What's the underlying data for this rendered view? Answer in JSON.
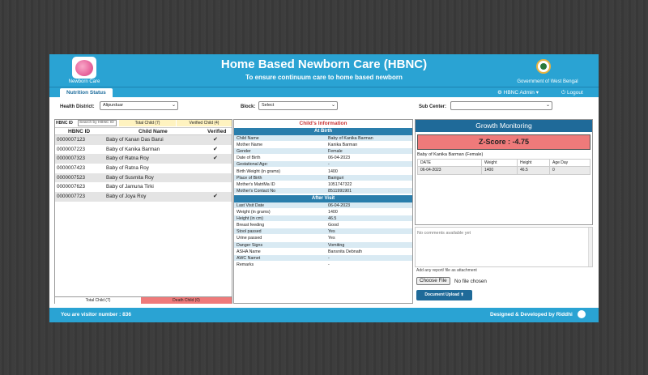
{
  "header": {
    "logo_caption": "Newborn Care",
    "title": "Home Based Newborn Care (HBNC)",
    "subtitle": "To ensure continuum care to home based newborn",
    "gov_caption": "Government of West Bengal"
  },
  "nav": {
    "tab": "Nutrition Status",
    "admin": "⚙ HBNC Admin ▾",
    "logout": "⏻ Logout"
  },
  "filters": {
    "district_label": "Health District:",
    "district_value": "Alipurduar",
    "block_label": "Block:",
    "block_value": "Select",
    "subcenter_label": "Sub Center:",
    "subcenter_value": ""
  },
  "list": {
    "search_label": "HBNC ID",
    "search_placeholder": "Search by HBNC ID",
    "total_badge": "Total Child (7)",
    "verified_badge": "Verified Child (4)",
    "col_id": "HBNC ID",
    "col_name": "Child Name",
    "col_verified": "Verified",
    "rows": [
      {
        "id": "0000007123",
        "name": "Baby of Kanan Das Barui",
        "verified": "✔"
      },
      {
        "id": "0000007223",
        "name": "Baby of Kanika Barman",
        "verified": "✔"
      },
      {
        "id": "0000007323",
        "name": "Baby of Ratna Roy",
        "verified": "✔"
      },
      {
        "id": "0000007423",
        "name": "Baby of Ratna Roy",
        "verified": ""
      },
      {
        "id": "0000007523",
        "name": "Baby of Susmita Roy",
        "verified": ""
      },
      {
        "id": "0000007623",
        "name": "Baby of Jamuna Tirki",
        "verified": ""
      },
      {
        "id": "0000007723",
        "name": "Baby of Joya Roy",
        "verified": "✔"
      }
    ],
    "footer_total": "Total Child (7)",
    "footer_death": "Death Child (0)"
  },
  "info": {
    "title": "Child's Information",
    "at_birth_label": "At Birth",
    "at_birth": [
      {
        "k": "Child Name",
        "v": "Baby of Kanika Barman"
      },
      {
        "k": "Mother Name",
        "v": "Kanika Barman"
      },
      {
        "k": "Gender",
        "v": "Female"
      },
      {
        "k": "Date of Birth",
        "v": "06-04-2023"
      },
      {
        "k": "Gestational Age:",
        "v": "-"
      },
      {
        "k": "Birth Weight (in grams)",
        "v": "1400"
      },
      {
        "k": "Place of Birth",
        "v": "Bairiguri"
      },
      {
        "k": "Mother's MatriMa ID",
        "v": "1051747322"
      },
      {
        "k": "Mother's Contact No",
        "v": "8511991901"
      }
    ],
    "after_visit_label": "After Visit",
    "after_visit": [
      {
        "k": "Last Visit Date",
        "v": "06-04-2023"
      },
      {
        "k": "Weight (in grams)",
        "v": "1400"
      },
      {
        "k": "Height (in cm)",
        "v": "46.5"
      },
      {
        "k": "Breast feeding",
        "v": "Good"
      },
      {
        "k": "Stool passed",
        "v": "Yes"
      },
      {
        "k": "Urine passed",
        "v": "Yes"
      },
      {
        "k": "Danger Signs",
        "v": "Vomiting"
      },
      {
        "k": "ASHA Name",
        "v": "Bansnita Debnath"
      },
      {
        "k": "AWC Namet",
        "v": "-"
      },
      {
        "k": "Remarks",
        "v": "-"
      }
    ]
  },
  "growth": {
    "title": "Growth Monitoring",
    "zscore": "Z-Score : -4.75",
    "baby": "Baby of Kanika Barman (Female)",
    "columns": [
      "DATE",
      "Weight",
      "Height",
      "Age Day"
    ],
    "row": [
      "06-04-2023",
      "1400",
      "46.5",
      "0"
    ],
    "comments_placeholder": "No comments available yet",
    "attach_label": "Add any report/ file as attachment",
    "file_button": "Choose File",
    "file_text": "No file chosen",
    "upload_button": "Document Upload ⬆"
  },
  "footer": {
    "visitor": "You are visitor number :   836",
    "credit": "Designed & Developed by Riddhi"
  },
  "colors": {
    "header_blue": "#2aa3d3",
    "dark_blue": "#1f6a99",
    "alert_red": "#ef7a7a"
  }
}
